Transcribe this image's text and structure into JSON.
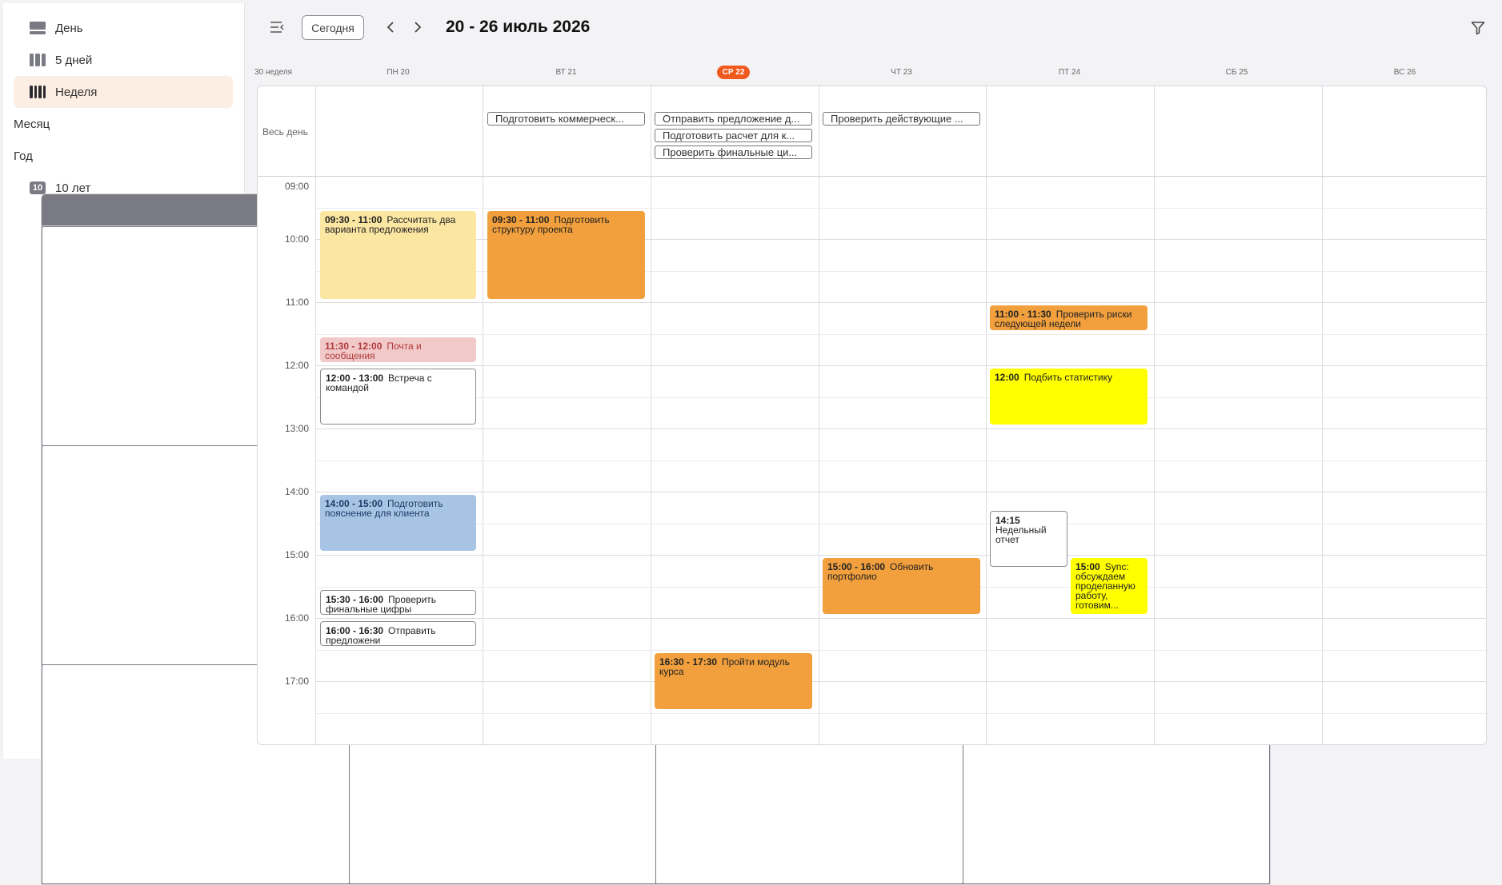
{
  "sidebar": {
    "items": [
      {
        "label": "День",
        "icon": "day-view-icon"
      },
      {
        "label": "5 дней",
        "icon": "five-days-view-icon"
      },
      {
        "label": "Неделя",
        "icon": "week-view-icon",
        "active": true
      },
      {
        "label": "Месяц",
        "icon": "month-view-icon"
      },
      {
        "label": "Год",
        "icon": "year-view-icon"
      },
      {
        "label": "10 лет",
        "icon": "decade-view-icon",
        "badge": "10"
      }
    ]
  },
  "toolbar": {
    "today_label": "Сегодня",
    "range_title": "20 - 26 июль 2026"
  },
  "calendar": {
    "week_label": "30 неделя",
    "all_day_label": "Весь день",
    "days": [
      {
        "label": "ПН 20"
      },
      {
        "label": "ВТ 21"
      },
      {
        "label": "СР 22",
        "today": true
      },
      {
        "label": "ЧТ 23"
      },
      {
        "label": "ПТ 24"
      },
      {
        "label": "СБ 25"
      },
      {
        "label": "ВС 26"
      }
    ],
    "hours": [
      "09:00",
      "10:00",
      "11:00",
      "12:00",
      "13:00",
      "14:00",
      "15:00",
      "16:00",
      "17:00"
    ],
    "all_day_events": [
      {
        "title": "Подготовить коммерческ...",
        "day": 1
      },
      {
        "title": "Отправить предложение д...",
        "day": 2
      },
      {
        "title": "Подготовить расчет для к...",
        "day": 2
      },
      {
        "title": "Проверить финальные ци...",
        "day": 2
      },
      {
        "title": "Проверить действующие ...",
        "day": 3
      }
    ],
    "events": [
      {
        "time": "09:30 - 11:00",
        "title": "Рассчитать два варианта предложения",
        "day": 0,
        "color": "#fbe6a2"
      },
      {
        "time": "09:30 - 11:00",
        "title": "Подготовить структуру проекта",
        "day": 1,
        "color": "#f2a03d"
      },
      {
        "time": "11:30 - 12:00",
        "title": "Почта и сообщения",
        "day": 0,
        "color": "#f2c9c9"
      },
      {
        "time": "12:00 - 13:00",
        "title": "Встреча с командой",
        "day": 0,
        "color": "#ffffff"
      },
      {
        "time": "14:00 - 15:00",
        "title": "Подготовить пояснение для клиента",
        "day": 0,
        "color": "#a8c4e4"
      },
      {
        "time": "15:30 - 16:00",
        "title": "Проверить финальные цифры",
        "day": 0,
        "color": "#ffffff"
      },
      {
        "time": "16:00 - 16:30",
        "title": "Отправить предложени",
        "day": 0,
        "color": "#ffffff"
      },
      {
        "time": "16:30 - 17:30",
        "title": "Пройти модуль курса",
        "day": 2,
        "color": "#f2a03d"
      },
      {
        "time": "15:00 - 16:00",
        "title": "Обновить портфолио",
        "day": 3,
        "color": "#f2a03d"
      },
      {
        "time": "11:00 - 11:30",
        "title": "Проверить риски следующей недели",
        "day": 4,
        "color": "#f2a03d"
      },
      {
        "time": "12:00",
        "title": "Подбить статистику",
        "day": 4,
        "color": "#ffff00"
      },
      {
        "time": "14:15",
        "title": "Недельный отчет",
        "day": 4,
        "color": "#ffffff"
      },
      {
        "time": "15:00",
        "title": "Sync: обсуждаем проделанную работу, готовим...",
        "day": 4,
        "color": "#ffff00"
      }
    ]
  }
}
